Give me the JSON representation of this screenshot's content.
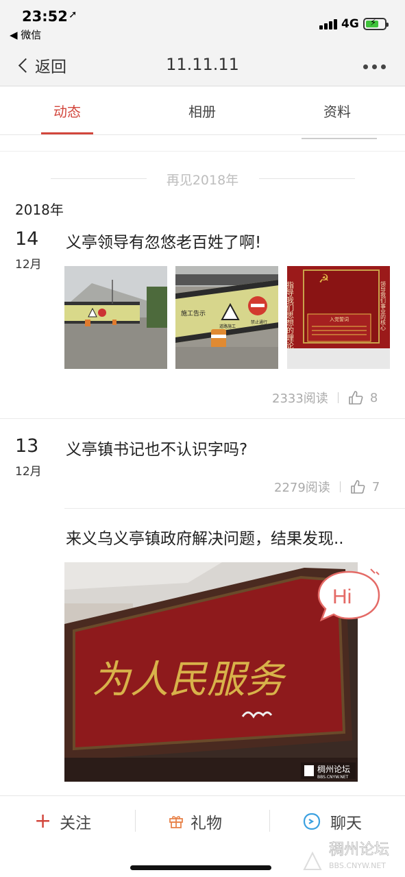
{
  "status_bar": {
    "time": "23:52",
    "back_app": "◀ 微信",
    "network": "4G"
  },
  "nav": {
    "back_label": "返回",
    "title": "11.11.11"
  },
  "tabs": [
    {
      "label": "动态",
      "active": true
    },
    {
      "label": "相册",
      "active": false
    },
    {
      "label": "资料",
      "active": false
    }
  ],
  "feed": {
    "year_divider": "再见2018年",
    "year_label": "2018年",
    "posts": [
      {
        "day": "14",
        "month": "12月",
        "title": "义亭领导有忽悠老百姓了啊!",
        "reads": "2333阅读",
        "likes": "8"
      },
      {
        "day": "13",
        "month": "12月",
        "title": "义亭镇书记也不认识字吗?",
        "reads": "2279阅读",
        "likes": "7"
      }
    ],
    "sub_post_title": "来义乌义亭镇政府解决问题，结果发现.."
  },
  "image_text": {
    "sign1_left": "施工告示",
    "sign1_mid": "道路施工",
    "sign1_right": "禁止通行",
    "board_title": "入党誓词",
    "board_v1": "指导我们思想的理论",
    "board_v2": "领导我们事业的核心",
    "plaque": "为人民服务",
    "hi": "Hi",
    "forum_name": "稠州论坛",
    "forum_url": "BBS.CNYW.NET"
  },
  "bottom_bar": {
    "follow": "关注",
    "gift": "礼物",
    "chat": "聊天"
  },
  "colors": {
    "accent": "#d2463c",
    "gift_orange": "#e8834a",
    "chat_blue": "#3aa0e0"
  }
}
